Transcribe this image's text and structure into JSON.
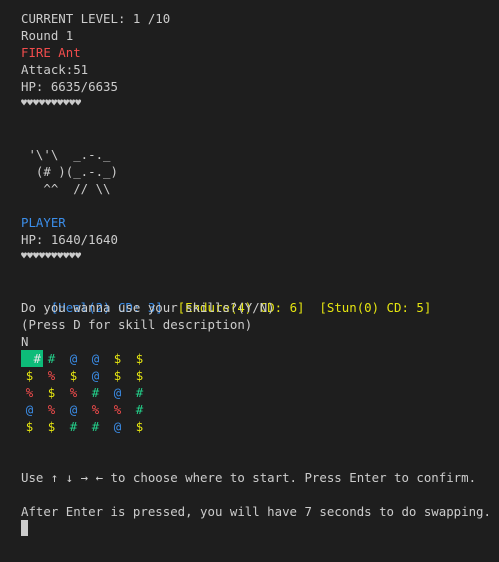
{
  "status": {
    "current_level": "CURRENT LEVEL: 1 /10",
    "round": "Round 1"
  },
  "enemy": {
    "name": "FIRE Ant",
    "attack": "Attack:51",
    "hp": "HP: 6635/6635",
    "hearts": "♥♥♥♥♥♥♥♥♥♥",
    "art": [
      " '\\'\\  _.-._",
      "  (# )(_.-._)",
      "   ^^  // \\\\"
    ]
  },
  "player": {
    "name": "PLAYER",
    "hp": "HP: 1640/1640",
    "hearts": "♥♥♥♥♥♥♥♥♥♥"
  },
  "skills": [
    {
      "label": "[Heal(2) CD: 3]",
      "color": "#3b8eea"
    },
    {
      "label": "[Endure(4) CD: 6]",
      "color": "#e5e510"
    },
    {
      "label": "[Stun(0) CD: 5]",
      "color": "#e5e510"
    }
  ],
  "prompt": {
    "question": "Do you wanna use your skills?(Y/N)",
    "hint": "(Press D for skill description)",
    "answer": "N"
  },
  "board": {
    "rows": [
      [
        "#",
        "#",
        "@",
        "@",
        "$",
        "$"
      ],
      [
        "$",
        "%",
        "$",
        "@",
        "$",
        "$"
      ],
      [
        "%",
        "$",
        "%",
        "#",
        "@",
        "#"
      ],
      [
        "@",
        "%",
        "@",
        "%",
        "%",
        "#"
      ],
      [
        "$",
        "$",
        "#",
        "#",
        "@",
        "$"
      ]
    ],
    "selected": [
      0,
      0
    ],
    "symbol_colors": {
      "#": "#23d18b",
      "@": "#3b8eea",
      "$": "#e5e510",
      "%": "#f14c4c"
    }
  },
  "instructions": {
    "choose": "Use ↑ ↓ → ← to choose where to start. Press Enter to confirm.",
    "after": "After Enter is pressed, you will have 7 seconds to do swapping."
  }
}
